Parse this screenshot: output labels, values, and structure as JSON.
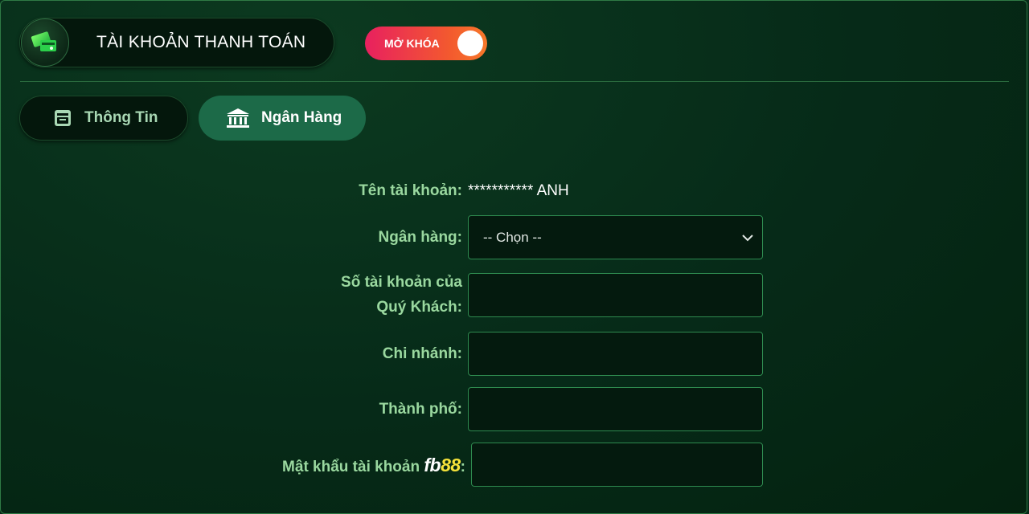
{
  "header": {
    "title": "TÀI KHOẢN THANH TOÁN",
    "toggle_label": "MỞ KHÓA",
    "title_icon": "card-payment-icon"
  },
  "tabs": [
    {
      "label": "Thông Tin",
      "icon": "info-box-icon",
      "active": false
    },
    {
      "label": "Ngân Hàng",
      "icon": "bank-icon",
      "active": true
    }
  ],
  "form": {
    "account_name_label": "Tên tài khoản:",
    "account_name_value": "*********** ANH",
    "bank_label": "Ngân hàng:",
    "bank_selected": "-- Chọn --",
    "account_number_label_1": "Số tài khoản của",
    "account_number_label_2": "Quý Khách:",
    "branch_label": "Chi nhánh:",
    "city_label": "Thành phố:",
    "password_label": "Mật khẩu tài khoản",
    "password_brand_fb": "fb",
    "password_brand_num": "88",
    "password_colon": ":"
  },
  "colors": {
    "background": "#062a18",
    "label": "#9ad89f",
    "active_tab": "#1c6a48",
    "toggle_start": "#e8205f",
    "toggle_end": "#f7782a",
    "brand_yellow": "#f5e23a"
  }
}
